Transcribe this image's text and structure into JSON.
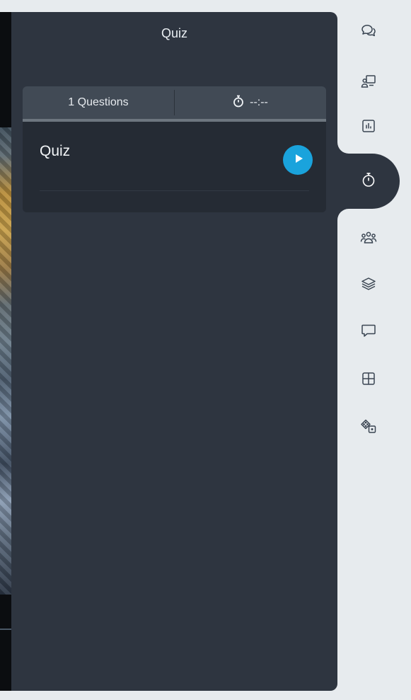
{
  "panel": {
    "title": "Quiz"
  },
  "quiz_card": {
    "questions_label": "1 Questions",
    "timer_value": "--:--",
    "quiz_title": "Quiz"
  },
  "rail": {
    "items": [
      {
        "icon": "chat-bubbles-icon"
      },
      {
        "icon": "presenter-icon"
      },
      {
        "icon": "poll-chart-icon"
      },
      {
        "icon": "stopwatch-icon",
        "active": true
      },
      {
        "icon": "group-icon"
      },
      {
        "icon": "layers-icon"
      },
      {
        "icon": "comment-icon"
      },
      {
        "icon": "grid-layout-icon"
      },
      {
        "icon": "dice-icon"
      }
    ]
  },
  "colors": {
    "panel_bg": "#2e3540",
    "card_bg": "#252b34",
    "card_header_bg": "#414a55",
    "accent": "#1aa3dc",
    "rail_bg": "#e7ebee",
    "icon_color": "#3a4552"
  }
}
